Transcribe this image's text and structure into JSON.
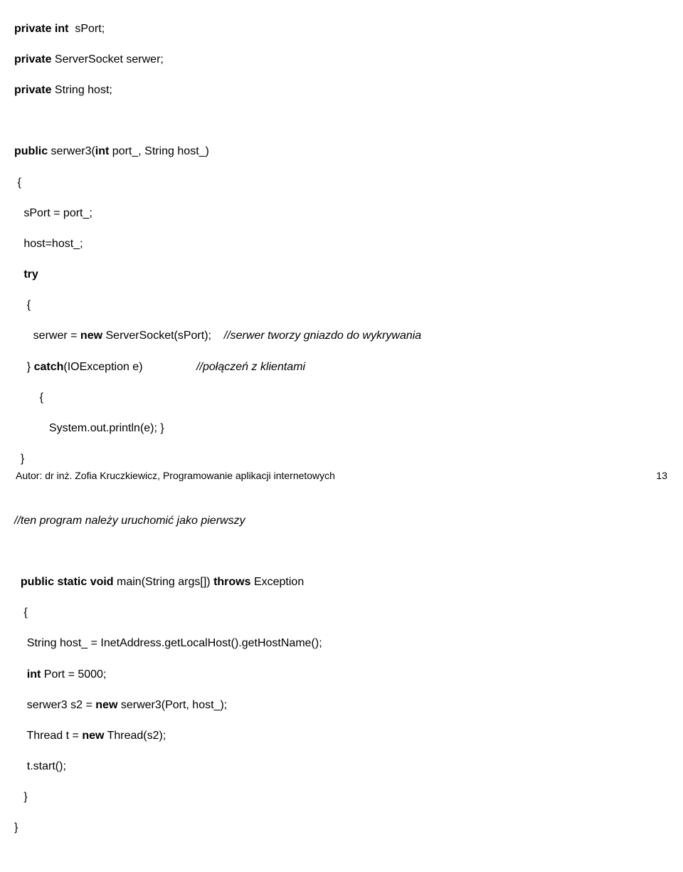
{
  "code": {
    "l1_a": "private int",
    "l1_b": "  sPort;",
    "l2_a": "private",
    "l2_b": " ServerSocket serwer;",
    "l3_a": "private",
    "l3_b": " String host;",
    "blank": " ",
    "l4_a": "public",
    "l4_b": " serwer3(",
    "l4_c": "int",
    "l4_d": " port_, String host_)",
    "l5": " {",
    "l6": "   sPort = port_;",
    "l7": "   host=host_;",
    "l8_a": "   ",
    "l8_b": "try",
    "l9": "    {",
    "l10_a": "      serwer = ",
    "l10_b": "new",
    "l10_c": " ServerSocket(sPort);",
    "l10_d": "    ",
    "l10_e": "//serwer tworzy gniazdo do wykrywania",
    "l11_a": "    } ",
    "l11_b": "catch",
    "l11_c": "(IOException e)",
    "l11_d": "                 ",
    "l11_e": "//połączeń z klientami",
    "l12": "        {",
    "l13": "           System.out.println(e); }",
    "l14": "  }",
    "l15": "//ten program należy uruchomić jako pierwszy",
    "l16_a": "  ",
    "l16_b": "public static void",
    "l16_c": " main(String args[]) ",
    "l16_d": "throws",
    "l16_e": " Exception",
    "l17": "   {",
    "l18": "    String host_ = InetAddress.getLocalHost().getHostName();",
    "l19_a": "    ",
    "l19_b": "int",
    "l19_c": " Port = 5000;",
    "l20_a": "    serwer3 s2 = ",
    "l20_b": "new",
    "l20_c": " serwer3(Port, host_);",
    "l21_a": "    Thread t = ",
    "l21_b": "new",
    "l21_c": " Thread(s2);",
    "l22": "    t.start();",
    "l23": "   }",
    "l24": "}"
  },
  "footer": {
    "left": "Autor:  dr inż. Zofia Kruczkiewicz, Programowanie aplikacji internetowych",
    "right": "13"
  }
}
